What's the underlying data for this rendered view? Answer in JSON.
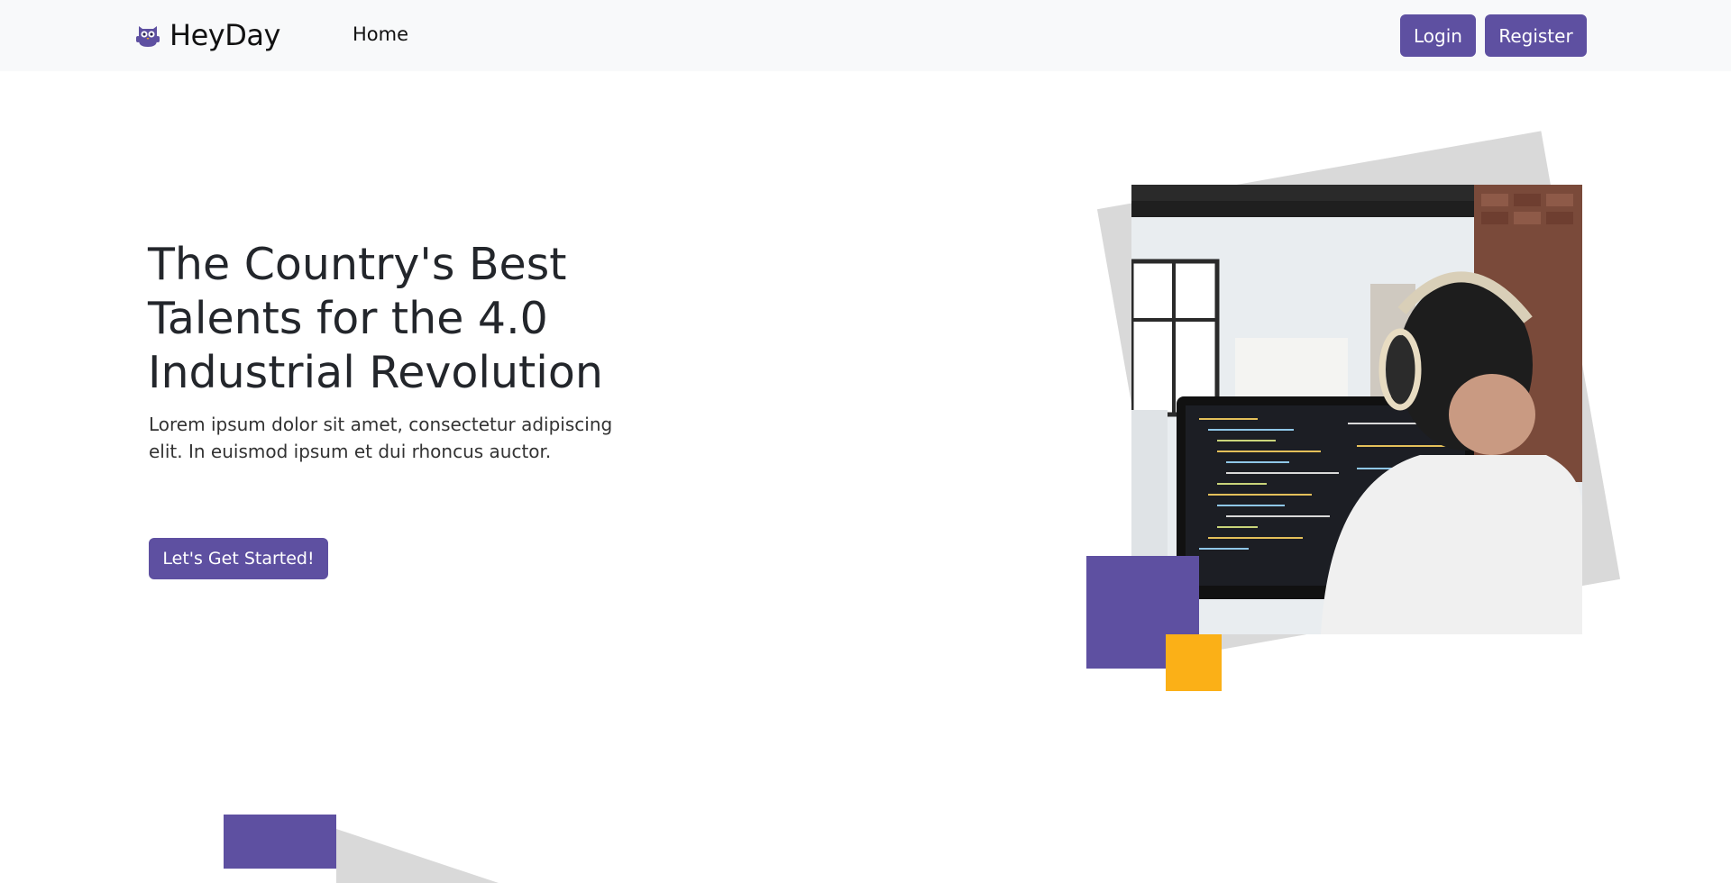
{
  "navbar": {
    "brand": "HeyDay",
    "brand_logo_icon": "owl-logo-icon",
    "home_link": "Home",
    "login_label": "Login",
    "register_label": "Register"
  },
  "hero": {
    "title": "The Country's Best Talents for the 4.0 Industrial Revolution",
    "description": "Lorem ipsum dolor sit amet, consectetur adipiscing elit. In euismod ipsum et dui rhoncus auctor.",
    "cta_label": "Let's Get Started!"
  },
  "colors": {
    "primary": "#5e50a1",
    "accent": "#fbb017",
    "navbar_bg": "#f8f9fa",
    "decor_grey": "#d9d9d9"
  }
}
